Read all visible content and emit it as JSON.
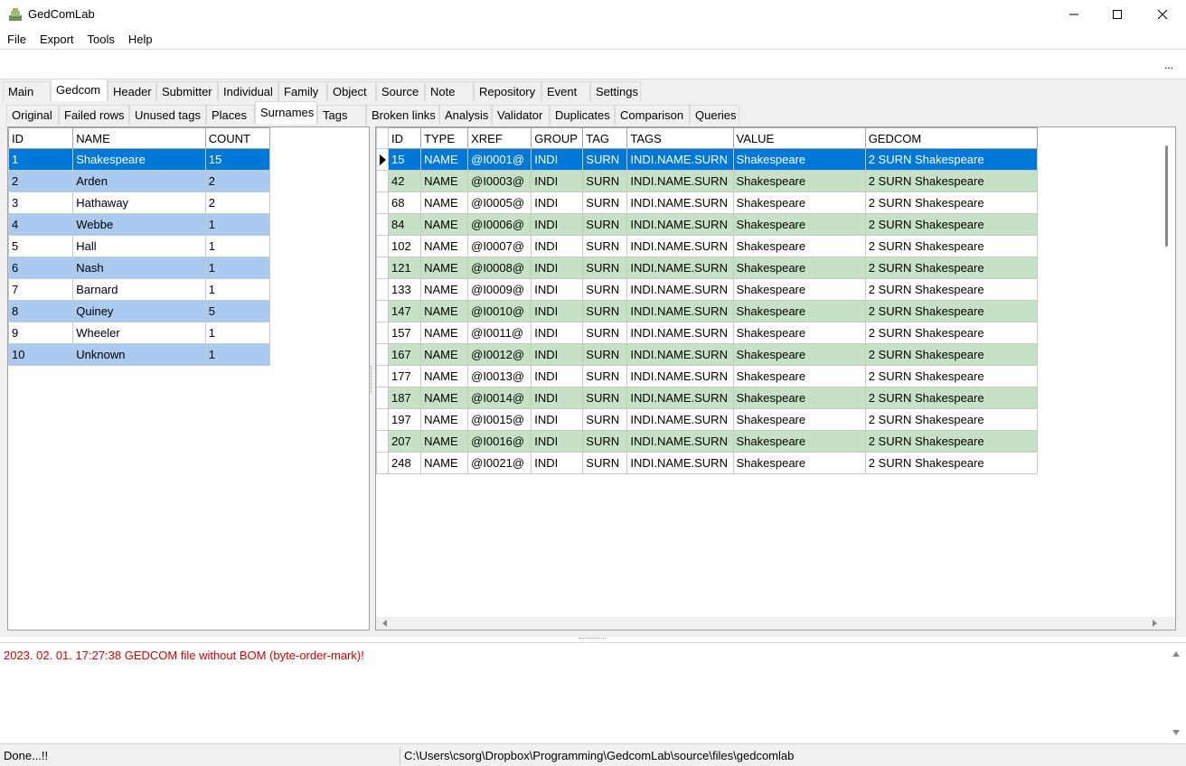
{
  "window": {
    "title": "GedComLab",
    "minimize_icon": "minimize-icon",
    "maximize_icon": "maximize-icon",
    "close_icon": "close-icon"
  },
  "menu": [
    "File",
    "Export",
    "Tools",
    "Help"
  ],
  "toolbar": {
    "overflow_label": "..."
  },
  "main_tabs": [
    "Main",
    "Gedcom",
    "Header",
    "Submitter",
    "Individual",
    "Family",
    "Object",
    "Source",
    "Note",
    "Repository",
    "Event",
    "Settings"
  ],
  "sub_tabs": [
    "Original",
    "Failed rows",
    "Unused tags",
    "Places",
    "Surnames",
    "Tags",
    "Broken links",
    "Analysis",
    "Validator",
    "Duplicates",
    "Comparison",
    "Queries"
  ],
  "active_main_tab": "Gedcom",
  "active_sub_tab": "Surnames",
  "surnames_table": {
    "columns": [
      "ID",
      "NAME",
      "COUNT"
    ],
    "rows": [
      [
        "1",
        "Shakespeare",
        "15"
      ],
      [
        "2",
        "Arden",
        "2"
      ],
      [
        "3",
        "Hathaway",
        "2"
      ],
      [
        "4",
        "Webbe",
        "1"
      ],
      [
        "5",
        "Hall",
        "1"
      ],
      [
        "6",
        "Nash",
        "1"
      ],
      [
        "7",
        "Barnard",
        "1"
      ],
      [
        "8",
        "Quiney",
        "5"
      ],
      [
        "9",
        "Wheeler",
        "1"
      ],
      [
        "10",
        "Unknown",
        "1"
      ]
    ]
  },
  "detail_table": {
    "columns": [
      "ID",
      "TYPE",
      "XREF",
      "GROUP",
      "TAG",
      "TAGS",
      "VALUE",
      "GEDCOM"
    ],
    "rows": [
      [
        "15",
        "NAME",
        "@I0001@",
        "INDI",
        "SURN",
        "INDI.NAME.SURN",
        "Shakespeare",
        "2 SURN Shakespeare"
      ],
      [
        "42",
        "NAME",
        "@I0003@",
        "INDI",
        "SURN",
        "INDI.NAME.SURN",
        "Shakespeare",
        "2 SURN Shakespeare"
      ],
      [
        "68",
        "NAME",
        "@I0005@",
        "INDI",
        "SURN",
        "INDI.NAME.SURN",
        "Shakespeare",
        "2 SURN Shakespeare"
      ],
      [
        "84",
        "NAME",
        "@I0006@",
        "INDI",
        "SURN",
        "INDI.NAME.SURN",
        "Shakespeare",
        "2 SURN Shakespeare"
      ],
      [
        "102",
        "NAME",
        "@I0007@",
        "INDI",
        "SURN",
        "INDI.NAME.SURN",
        "Shakespeare",
        "2 SURN Shakespeare"
      ],
      [
        "121",
        "NAME",
        "@I0008@",
        "INDI",
        "SURN",
        "INDI.NAME.SURN",
        "Shakespeare",
        "2 SURN Shakespeare"
      ],
      [
        "133",
        "NAME",
        "@I0009@",
        "INDI",
        "SURN",
        "INDI.NAME.SURN",
        "Shakespeare",
        "2 SURN Shakespeare"
      ],
      [
        "147",
        "NAME",
        "@I0010@",
        "INDI",
        "SURN",
        "INDI.NAME.SURN",
        "Shakespeare",
        "2 SURN Shakespeare"
      ],
      [
        "157",
        "NAME",
        "@I0011@",
        "INDI",
        "SURN",
        "INDI.NAME.SURN",
        "Shakespeare",
        "2 SURN Shakespeare"
      ],
      [
        "167",
        "NAME",
        "@I0012@",
        "INDI",
        "SURN",
        "INDI.NAME.SURN",
        "Shakespeare",
        "2 SURN Shakespeare"
      ],
      [
        "177",
        "NAME",
        "@I0013@",
        "INDI",
        "SURN",
        "INDI.NAME.SURN",
        "Shakespeare",
        "2 SURN Shakespeare"
      ],
      [
        "187",
        "NAME",
        "@I0014@",
        "INDI",
        "SURN",
        "INDI.NAME.SURN",
        "Shakespeare",
        "2 SURN Shakespeare"
      ],
      [
        "197",
        "NAME",
        "@I0015@",
        "INDI",
        "SURN",
        "INDI.NAME.SURN",
        "Shakespeare",
        "2 SURN Shakespeare"
      ],
      [
        "207",
        "NAME",
        "@I0016@",
        "INDI",
        "SURN",
        "INDI.NAME.SURN",
        "Shakespeare",
        "2 SURN Shakespeare"
      ],
      [
        "248",
        "NAME",
        "@I0021@",
        "INDI",
        "SURN",
        "INDI.NAME.SURN",
        "Shakespeare",
        "2 SURN Shakespeare"
      ]
    ]
  },
  "log": {
    "message": "2023. 02. 01. 17:27:38 GEDCOM file without BOM (byte-order-mark)!"
  },
  "status": {
    "left": "Done...!!",
    "path": "C:\\Users\\csorg\\Dropbox\\Programming\\GedcomLab\\source\\files\\gedcomlab"
  },
  "colors": {
    "selection": "#0078d7",
    "left_alt_row": "#a9cbef",
    "right_alt_row": "#c6e2c6",
    "log_error": "#d20000"
  }
}
